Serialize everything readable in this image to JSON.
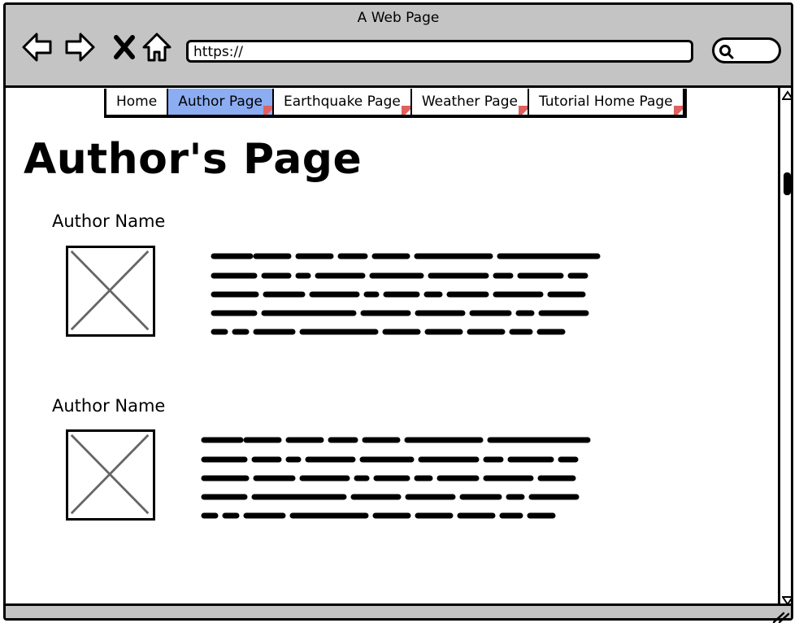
{
  "window": {
    "title": "A Web Page"
  },
  "address_bar": {
    "url": "https://"
  },
  "nav": {
    "items": [
      {
        "label": "Home",
        "active": false,
        "has_link_marker": false
      },
      {
        "label": "Author Page",
        "active": true,
        "has_link_marker": true
      },
      {
        "label": "Earthquake Page",
        "active": false,
        "has_link_marker": true
      },
      {
        "label": "Weather Page",
        "active": false,
        "has_link_marker": true
      },
      {
        "label": "Tutorial Home Page",
        "active": false,
        "has_link_marker": true
      }
    ]
  },
  "page": {
    "title": "Author's Page",
    "authors": [
      {
        "name": "Author Name",
        "image": "image-placeholder",
        "bio": "placeholder-scribble-text"
      },
      {
        "name": "Author Name",
        "image": "image-placeholder",
        "bio": "placeholder-scribble-text"
      }
    ]
  },
  "icons": {
    "back": "back-arrow-icon",
    "forward": "forward-arrow-icon",
    "stop": "stop-x-icon",
    "home": "home-icon",
    "search": "search-icon",
    "scroll_up": "scroll-up-icon",
    "scroll_down": "scroll-down-icon",
    "resize": "resize-grip-icon"
  },
  "colors": {
    "chrome": "#c4c4c4",
    "active_tab": "#8cadf2",
    "link_marker": "#e06060",
    "placeholder_x": "#666666"
  }
}
